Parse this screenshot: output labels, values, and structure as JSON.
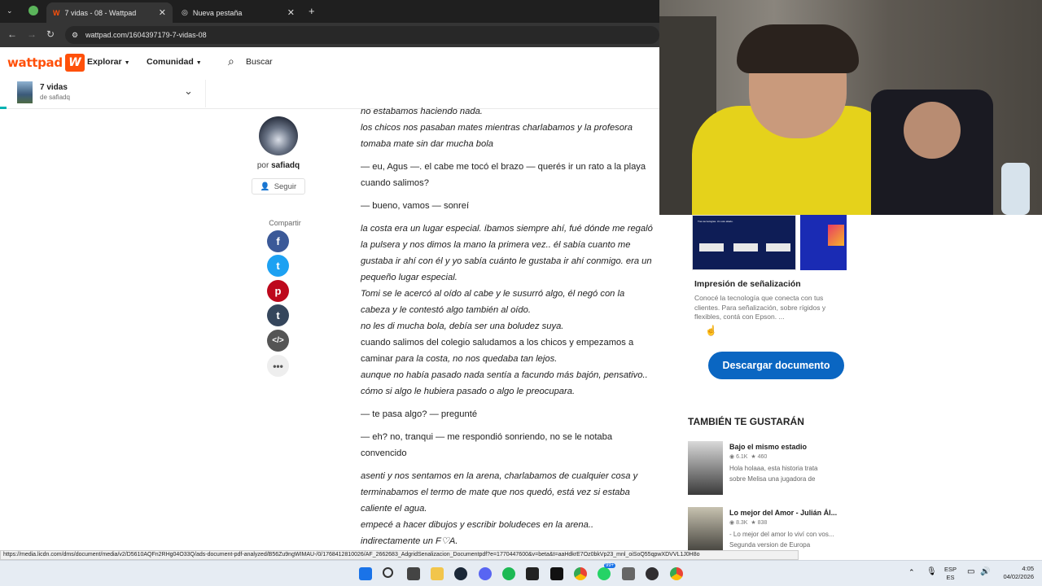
{
  "browser": {
    "tabs": [
      {
        "title": "7 vidas - 08 - Wattpad",
        "active": true
      },
      {
        "title": "Nueva pestaña",
        "active": false
      }
    ],
    "new_tab": "+",
    "url": "wattpad.com/1604397179-7-vidas-08"
  },
  "header": {
    "logo": "wattpad",
    "explore": "Explorar",
    "community": "Comunidad",
    "search": "Buscar"
  },
  "story_bar": {
    "title": "7 vidas",
    "author": "de safiadq"
  },
  "author": {
    "prefix": "por",
    "name": "safiadq",
    "follow": "Seguir",
    "share_label": "Compartir",
    "share_icons": [
      "facebook-icon",
      "twitter-icon",
      "pinterest-icon",
      "tumblr-icon",
      "embed-icon",
      "more-icon"
    ]
  },
  "story": {
    "paragraphs": [
      {
        "italic": true,
        "text": "no estabamos haciendo nada.\nlos chicos nos pasaban mates mientras charlabamos y la profesora tomaba mate sin dar mucha bola"
      },
      {
        "italic": false,
        "text": "— eu, Agus —. el cabe me tocó el brazo — querés ir un rato a la playa cuando salimos?"
      },
      {
        "italic": false,
        "text": "— bueno, vamos — sonreí"
      },
      {
        "italic": true,
        "text": "la costa era un lugar especial. íbamos siempre ahí, fué dónde me regaló la pulsera y nos dimos la mano la primera vez.. él sabía cuanto me gustaba ir ahí con él y yo sabía cuánto le gustaba ir ahí conmigo. era un pequeño lugar especial.\nTomi se le acercó al oído al cabe y le susurró algo, él negó con la cabeza y le contestó algo también al oído.\nno les di mucha bola, debía ser una boludez suya."
      },
      {
        "italic": false,
        "text": "cuando salimos del colegio saludamos a los chicos y empezamos a caminar "
      },
      {
        "italic": true,
        "text": "para la costa, no nos quedaba tan lejos.\naunque no había pasado nada sentía a facundo más bajón, pensativo.. cómo si algo le hubiera pasado o algo le preocupara."
      },
      {
        "italic": false,
        "text": "— te pasa algo? — pregunté"
      },
      {
        "italic": false,
        "text": "— eh? no, tranqui — me respondió sonriendo, no se le notaba convencido"
      },
      {
        "italic": true,
        "text": "asenti y nos sentamos en la arena, charlabamos de cualquier cosa y terminabamos el termo de mate que nos quedó, está vez si estaba caliente el agua.\nempecé a hacer dibujos y escribir boludeces en la arena..\nindirectamente un F♡A."
      }
    ]
  },
  "ad": {
    "image_caption": "Tres tecnologías. Un solo aliado.",
    "title": "Impresión de señalización",
    "text": "Conocé la tecnología que conecta con tus clientes. Para señalización, sobre rígidos y flexibles, contá con Epson. ...",
    "button": "Descargar documento"
  },
  "also_like": {
    "heading": "TAMBIÉN TE GUSTARÁN",
    "items": [
      {
        "title": "Bajo el mismo estadio",
        "reads": "6.1K",
        "votes": "460",
        "desc": "Hola holaaa, esta historia trata sobre Melisa una jugadora de"
      },
      {
        "title": "Lo mejor del Amor - Julián Ál...",
        "reads": "8.3K",
        "votes": "838",
        "desc": "- Lo mejor del amor lo viví con vos... Segunda version de Europa"
      }
    ]
  },
  "status_url": "https://media.licdn.com/dms/document/media/v2/D5610AQFn2RHg04O33Q/ads-document-pdf-analyzed/B56Zu9ngWIMAU-/0/1768412810026/AF_2662683_AdgridSenalizacion_Documentpdf?e=1770447600&v=beta&t=aaHdkrE7Oz0bkVp23_mnl_oiSoQ55qpwXDVVL1J0H8o",
  "taskbar": {
    "lang_top": "ESP",
    "lang_bottom": "ES",
    "time": "4:05",
    "date": "04/02/2026",
    "badge": "99+"
  },
  "colors": {
    "wattpad_orange": "#ff500a",
    "linkedin_blue": "#0a66c2"
  }
}
